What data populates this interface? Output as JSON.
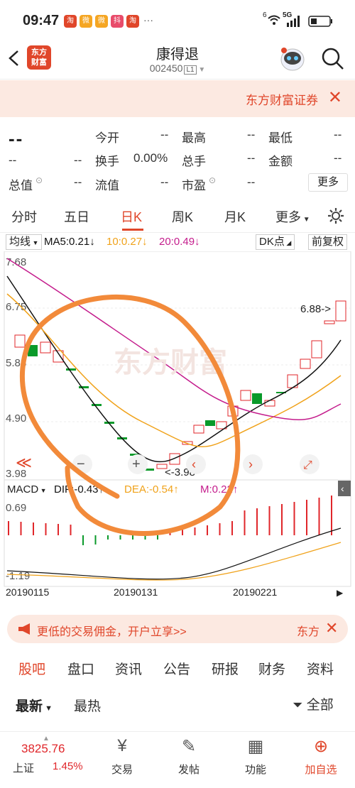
{
  "status_bar": {
    "time": "09:47",
    "badges": [
      "淘",
      "微",
      "微",
      "抖",
      "淘",
      "···"
    ],
    "signal": "5G",
    "network_prefix": "6"
  },
  "header": {
    "logo_line1": "东方",
    "logo_line2": "财富",
    "stock_name": "康得退",
    "stock_code": "002450",
    "level": "L1"
  },
  "banner": {
    "text": "东方财富证券",
    "close": "✕"
  },
  "quote": {
    "price": "--",
    "change": "--",
    "change_pct": "--",
    "row1": [
      {
        "label": "今开",
        "value": "--"
      },
      {
        "label": "最高",
        "value": "--"
      },
      {
        "label": "最低",
        "value": "--"
      }
    ],
    "row2": [
      {
        "label": "换手",
        "value": "0.00%"
      },
      {
        "label": "总手",
        "value": "--"
      },
      {
        "label": "金额",
        "value": "--"
      }
    ],
    "row3": [
      {
        "label": "总值",
        "value": "--"
      },
      {
        "label": "流值",
        "value": "--"
      },
      {
        "label": "市盈",
        "value": "--"
      }
    ],
    "more": "更多"
  },
  "tabs": [
    "分时",
    "五日",
    "日K",
    "周K",
    "月K",
    "更多"
  ],
  "active_tab": "日K",
  "ma_bar": {
    "select": "均线",
    "ma5": "MA5:0.21",
    "ma10": "10:0.27",
    "ma20": "20:0.49",
    "dk": "DK点",
    "adjust": "前复权"
  },
  "chart_data": {
    "type": "candlestick",
    "y_ticks": [
      "7.68",
      "6.75",
      "5.83",
      "4.90",
      "3.98"
    ],
    "ylim": [
      3.98,
      7.68
    ],
    "high_label": "6.88->",
    "low_label": "<-3.98",
    "x_ticks": [
      "20190115",
      "20190131",
      "20190221"
    ],
    "macd": {
      "label": "MACD",
      "dif": "DIF:-0.43",
      "dea": "DEA:-0.54",
      "m": "M:0.22",
      "top": "0.69",
      "bottom": "-1.19"
    },
    "colors": {
      "up": "#e0262a",
      "down": "#0a9a2a",
      "ma5": "#111111",
      "ma10": "#f0a21a",
      "ma20": "#c41c8c"
    }
  },
  "promo": {
    "text": "更低的交易佣金，开户立享>>",
    "tail": "东方"
  },
  "sub_tabs": [
    "股吧",
    "盘口",
    "资讯",
    "公告",
    "研报",
    "财务",
    "资料"
  ],
  "active_sub_tab": "股吧",
  "filters": {
    "latest": "最新",
    "hot": "最热",
    "all": "全部"
  },
  "bottom_nav": {
    "index_value": "3825.76",
    "index_name": "上证",
    "index_pct": "1.45%",
    "items": [
      "交易",
      "发帖",
      "功能",
      "加自选"
    ]
  }
}
